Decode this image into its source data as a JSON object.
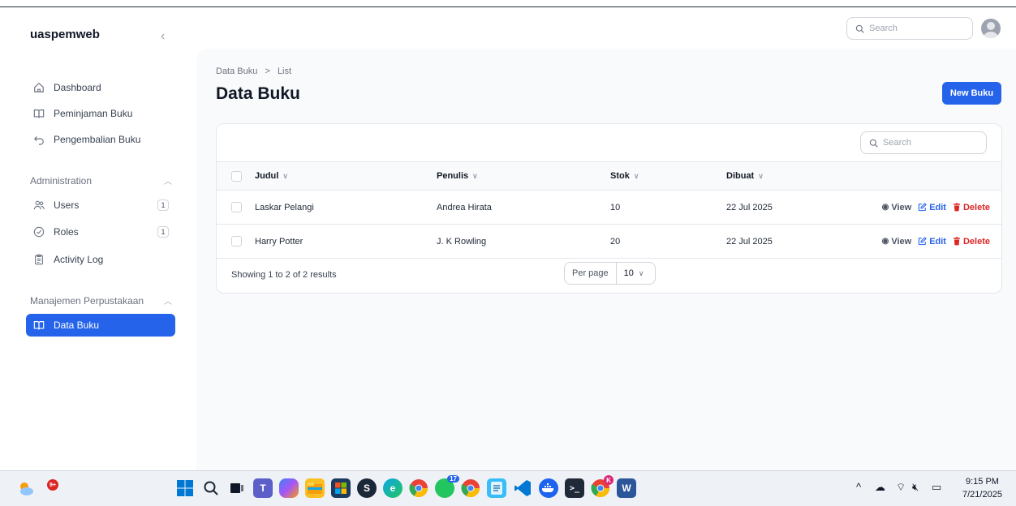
{
  "app": {
    "brand": "uaspemweb",
    "collapse_glyph": "‹"
  },
  "topbar": {
    "search_placeholder": "Search"
  },
  "sidebar": {
    "items": [
      {
        "label": "Dashboard"
      },
      {
        "label": "Peminjaman Buku"
      },
      {
        "label": "Pengembalian Buku"
      }
    ],
    "admin_group": {
      "label": "Administration",
      "items": [
        {
          "label": "Users",
          "badge": "1"
        },
        {
          "label": "Roles",
          "badge": "1"
        },
        {
          "label": "Activity Log"
        }
      ]
    },
    "library_group": {
      "label": "Manajemen Perpustakaan",
      "items": [
        {
          "label": "Data Buku",
          "active": true
        }
      ]
    }
  },
  "page": {
    "breadcrumb_root": "Data Buku",
    "breadcrumb_sep": ">",
    "breadcrumb_current": "List",
    "title": "Data Buku",
    "new_button": "New Buku"
  },
  "table": {
    "search_placeholder": "Search",
    "columns": [
      "Judul",
      "Penulis",
      "Stok",
      "Dibuat"
    ],
    "rows": [
      {
        "judul": "Laskar Pelangi",
        "penulis": "Andrea Hirata",
        "stok": "10",
        "dibuat": "22 Jul 2025"
      },
      {
        "judul": "Harry Potter",
        "penulis": "J. K Rowling",
        "stok": "20",
        "dibuat": "22 Jul 2025"
      }
    ],
    "actions": {
      "view": "View",
      "edit": "Edit",
      "delete": "Delete"
    },
    "footer": {
      "summary": "Showing 1 to 2 of 2 results",
      "per_page_label": "Per page",
      "per_page_value": "10"
    }
  },
  "taskbar": {
    "weather_badge": "9+",
    "chrome_badge": "17",
    "profile_badge": "K",
    "clock_time": "9:15 PM",
    "clock_date": "7/21/2025"
  },
  "colors": {
    "accent": "#2563eb",
    "danger": "#dc2626"
  }
}
